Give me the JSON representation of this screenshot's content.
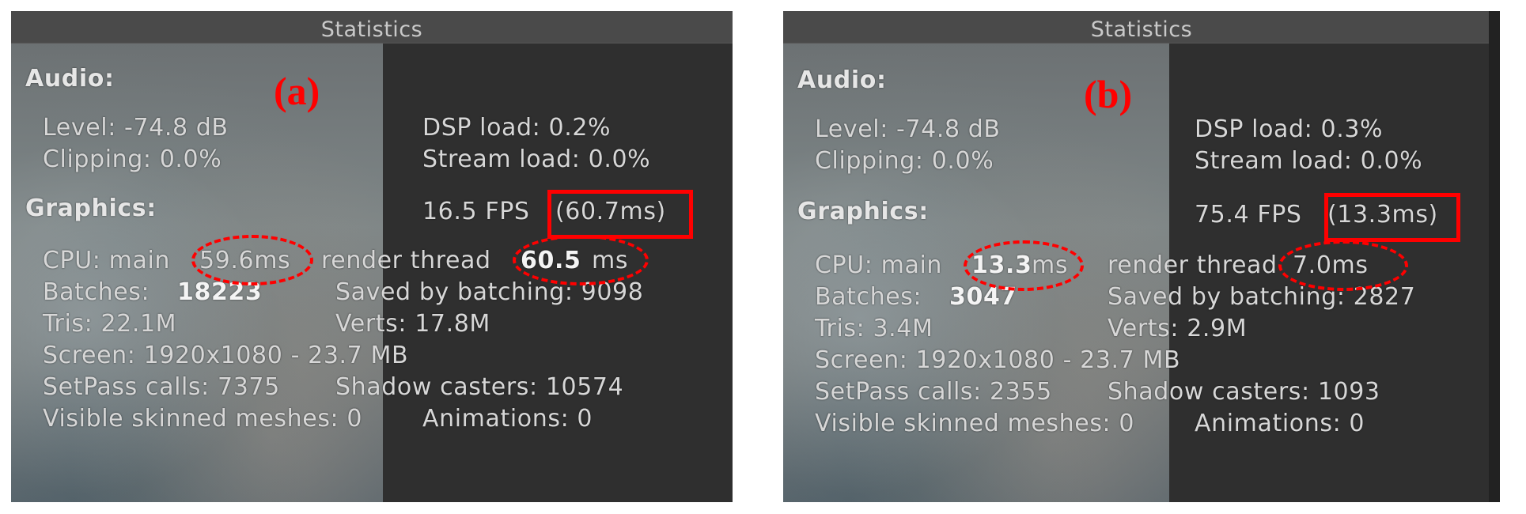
{
  "panels": [
    {
      "figure_label": "(a)",
      "title": "Statistics",
      "audio": {
        "heading": "Audio:",
        "level": "Level: -74.8 dB",
        "clipping": "Clipping: 0.0%",
        "dsp_load": "DSP load: 0.2%",
        "stream_load": "Stream load: 0.0%"
      },
      "graphics": {
        "heading": "Graphics:",
        "fps": "16.5 FPS",
        "frame_time": "(60.7ms)",
        "cpu_main_label": "CPU: main",
        "cpu_main_value": "59.6ms",
        "render_thread_label": "render thread",
        "render_thread_value": "60.5",
        "render_thread_unit": "ms",
        "batches_label": "Batches:",
        "batches_value": "18223",
        "saved_by_batching": "Saved by batching: 9098",
        "tris": "Tris: 22.1M",
        "verts": "Verts: 17.8M",
        "screen": "Screen: 1920x1080 - 23.7 MB",
        "setpass": "SetPass calls: 7375",
        "shadow_casters": "Shadow casters: 10574",
        "skinned_meshes": "Visible skinned meshes: 0",
        "animations": "Animations: 0"
      }
    },
    {
      "figure_label": "(b)",
      "title": "Statistics",
      "audio": {
        "heading": "Audio:",
        "level": "Level: -74.8 dB",
        "clipping": "Clipping: 0.0%",
        "dsp_load": "DSP load: 0.3%",
        "stream_load": "Stream load: 0.0%"
      },
      "graphics": {
        "heading": "Graphics:",
        "fps": "75.4 FPS",
        "frame_time": "(13.3ms)",
        "cpu_main_label": "CPU: main",
        "cpu_main_value": "13.3",
        "cpu_main_unit": "ms",
        "render_thread_label": "render thread",
        "render_thread_value": "7.0ms",
        "batches_label": "Batches:",
        "batches_value": "3047",
        "saved_by_batching": "Saved by batching: 2827",
        "tris": "Tris: 3.4M",
        "verts": "Verts: 2.9M",
        "screen": "Screen: 1920x1080 - 23.7 MB",
        "setpass": "SetPass calls: 2355",
        "shadow_casters": "Shadow casters: 1093",
        "skinned_meshes": "Visible skinned meshes: 0",
        "animations": "Animations: 0"
      }
    }
  ],
  "colors": {
    "annotation": "#ff0000",
    "panel_bg": "#3a3a3a",
    "text": "#d7d7d7"
  }
}
